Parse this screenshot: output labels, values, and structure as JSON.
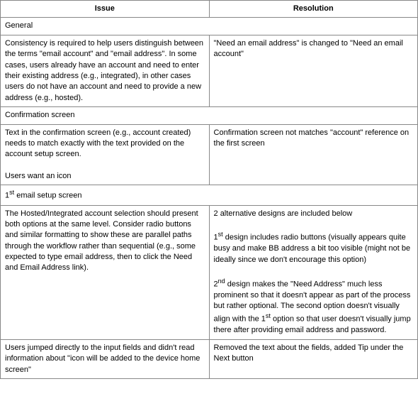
{
  "table": {
    "headers": {
      "issue": "Issue",
      "resolution": "Resolution"
    },
    "sections": [
      {
        "section_label": "General",
        "rows": [
          {
            "issue": "Consistency is required to help users distinguish between the terms \"email account\" and \"email address\".  In some cases, users already have an account and need to enter their existing address (e.g., integrated), in other cases users do not have an account and need to provide a new address (e.g., hosted).",
            "resolution": "\"Need an email address\" is changed to \"Need an email account\""
          }
        ]
      },
      {
        "section_label": "Confirmation screen",
        "rows": [
          {
            "issue": "Text in the confirmation screen (e.g., account created) needs to match exactly with the text provided on the account setup screen.\n\nUsers want an icon",
            "resolution": "Confirmation screen not matches \"account\" reference on the first screen"
          }
        ]
      },
      {
        "section_label": "1st email setup screen",
        "section_label_sup": "st",
        "section_label_base": "1",
        "section_label_suffix": " email setup screen",
        "rows": [
          {
            "issue": "The Hosted/Integrated account selection should present both options at the same level. Consider radio buttons and similar formatting to show these are parallel paths through the workflow rather than sequential (e.g., some expected to type email address, then to click the Need and Email Address link).",
            "resolution_parts": [
              "2 alternative designs are included below",
              "1st design includes radio buttons (visually appears quite busy and make BB address a bit too visible (might not be ideally since we don't encourage this option)",
              "2nd design makes the \"Need Address\" much less prominent so that it doesn't appear as part of the process but rather optional. The second option doesn't visually align with the 1st option so that user doesn't visually jump there after providing email address and password."
            ]
          },
          {
            "issue": "Users jumped directly to the input fields and didn't read information about \"icon will be added to the device home screen\"",
            "resolution": "Removed the text about the fields, added Tip under the Next button"
          }
        ]
      }
    ]
  }
}
